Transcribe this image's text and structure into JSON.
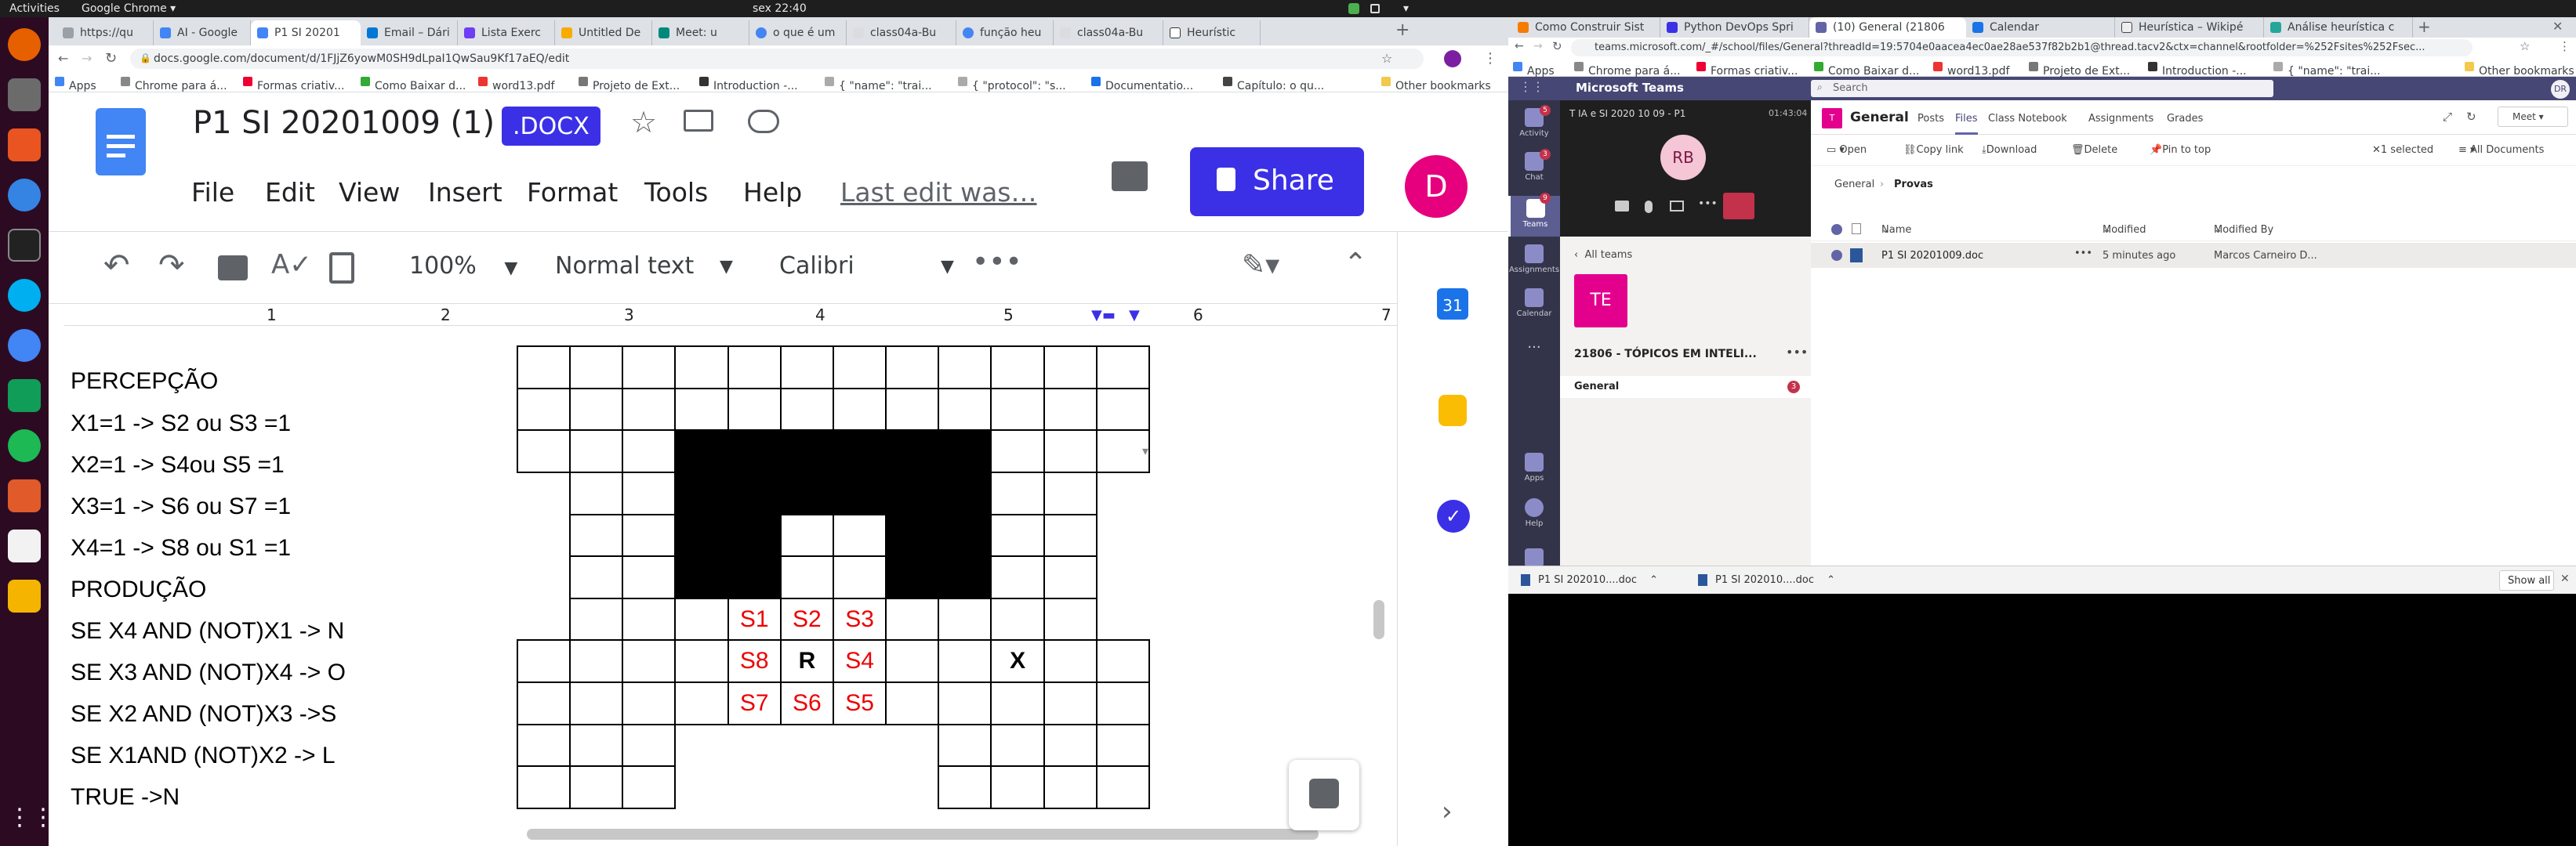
{
  "system": {
    "activities": "Activities",
    "app_menu": "Google Chrome ▾",
    "clock": "sex 22:40"
  },
  "left_browser": {
    "tabs": [
      "https://qu",
      "AI - Google",
      "P1 SI 20201",
      "Email – Dári",
      "Lista Exerc",
      "Untitled De",
      "Meet: u",
      "o que é um",
      "class04a-Bu",
      "função heu",
      "class04a-Bu",
      "Heurístic"
    ],
    "url": "docs.google.com/document/d/1FJjZ6yowM0SH9dLpaI1QwSau9Kf17aEQ/edit",
    "bookmarks": [
      "Apps",
      "Chrome para á...",
      "Formas criativ...",
      "Como Baixar d...",
      "word13.pdf",
      "Projeto de Ext...",
      "Introduction -...",
      "{ \"name\": \"trai...",
      "{ \"protocol\": \"s...",
      "Documentatio...",
      "Capítulo: o qu...",
      "Other bookmarks"
    ]
  },
  "docs": {
    "title": "P1 SI 20201009 (1)",
    "badge": ".DOCX",
    "share": "Share",
    "avatar": "D",
    "menus": [
      "File",
      "Edit",
      "View",
      "Insert",
      "Format",
      "Tools",
      "Help"
    ],
    "last_edit": "Last edit was…",
    "toolbar": {
      "zoom": "100%",
      "style": "Normal text",
      "font": "Calibri"
    },
    "ruler": [
      "1",
      "2",
      "3",
      "4",
      "5",
      "6",
      "7"
    ],
    "lines": [
      "PERCEPÇÃO",
      "X1=1 -> S2 ou S3 =1",
      "X2=1 -> S4ou S5 =1",
      "X3=1 -> S6 ou S7 =1",
      "X4=1 -> S8 ou S1 =1",
      "PRODUÇÃO",
      "SE X4 AND (NOT)X1 -> N",
      "SE X3 AND (NOT)X4 -> O",
      "SE X2 AND (NOT)X3 ->S",
      "SE X1AND (NOT)X2 -> L",
      "TRUE ->N"
    ],
    "grid_labels": {
      "S1": "S1",
      "S2": "S2",
      "S3": "S3",
      "S8": "S8",
      "R": "R",
      "S4": "S4",
      "X": "X",
      "S7": "S7",
      "S6": "S6",
      "S5": "S5"
    },
    "side_icons": [
      "calendar-31",
      "keep",
      "tasks"
    ],
    "calendar_day": "31"
  },
  "right_browser": {
    "tabs": [
      "Como Construir Sist",
      "Python DevOps Spri",
      "(10) General (21806",
      "Calendar",
      "Heurística – Wikipé",
      "Análise heurística c"
    ],
    "url": "teams.microsoft.com/_#/school/files/General?threadId=19:5704e0aacea4ec0ae28ae537f82b2b1@thread.tacv2&ctx=channel&rootfolder=%252Fsites%252Fsec...",
    "bookmarks": [
      "Apps",
      "Chrome para á...",
      "Formas criativ...",
      "Como Baixar d...",
      "word13.pdf",
      "Projeto de Ext...",
      "Introduction -...",
      "{ \"name\": \"trai...",
      "Other bookmarks"
    ]
  },
  "teams": {
    "app": "Microsoft Teams",
    "search": "Search",
    "me": "DR",
    "rail": [
      "Activity",
      "Chat",
      "Teams",
      "Assignments",
      "Calendar",
      "...",
      "Apps",
      "Help"
    ],
    "rail_badges": [
      "5",
      "3",
      "9"
    ],
    "call_title": "T IA e SI 2020 10 09 - P1",
    "call_time": "01:43:04",
    "call_avatar": "RB",
    "all_teams": "All teams",
    "team_tile": "TE",
    "team_name": "21806 - TÓPICOS EM INTELI...",
    "channel": "General",
    "channel_badge": "3",
    "header_icon": "T",
    "header_title": "General",
    "tabs": [
      "Posts",
      "Files",
      "Class Notebook",
      "Assignments",
      "Grades"
    ],
    "meet": "Meet",
    "actions": [
      "Open",
      "Copy link",
      "Download",
      "Delete",
      "Pin to top"
    ],
    "selected": "1 selected",
    "all_docs": "All Documents",
    "breadcrumb": [
      "General",
      "Provas"
    ],
    "cols": [
      "Name",
      "Modified",
      "Modified By"
    ],
    "file": {
      "name": "P1 SI 20201009.doc",
      "modified": "5 minutes ago",
      "by": "Marcos Carneiro D..."
    }
  },
  "downloads": {
    "items": [
      "P1 SI 202010....doc",
      "P1 SI 202010....doc"
    ],
    "show_all": "Show all"
  }
}
